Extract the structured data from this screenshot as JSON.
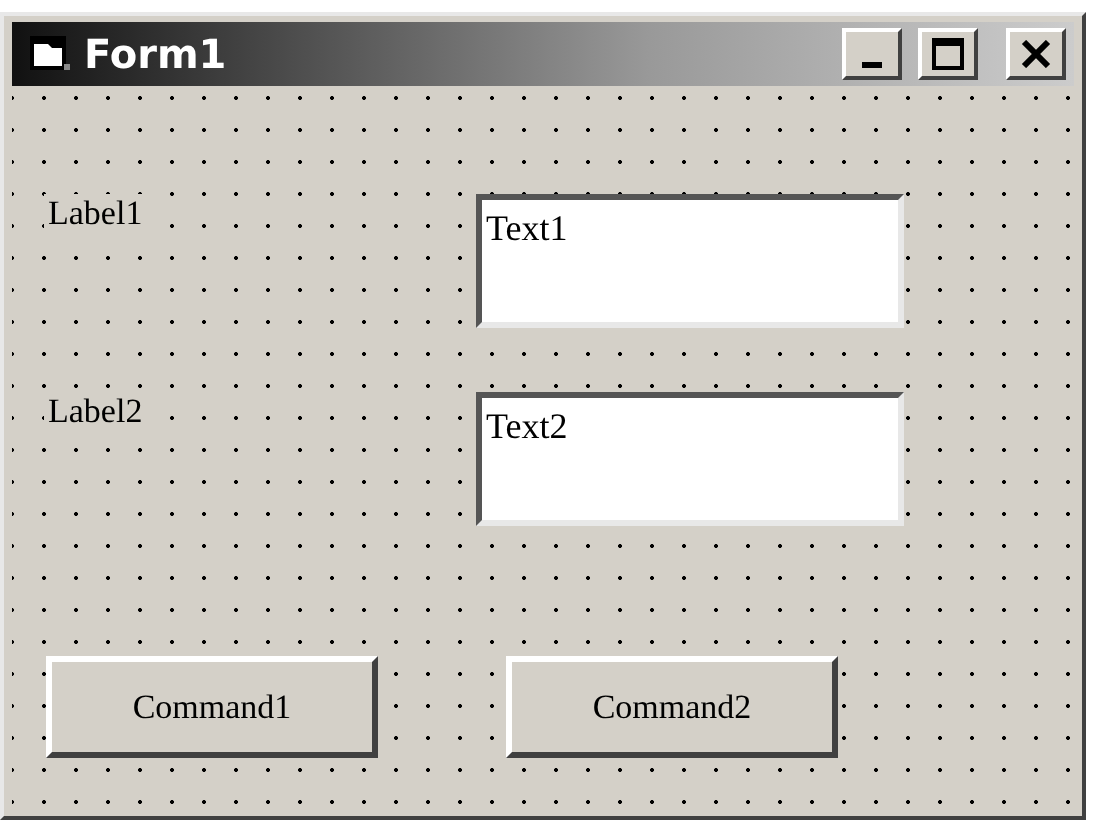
{
  "window": {
    "title": "Form1"
  },
  "labels": [
    "Label1",
    "Label2"
  ],
  "textboxes": [
    {
      "value": "Text1"
    },
    {
      "value": "Text2"
    }
  ],
  "buttons": [
    "Command1",
    "Command2"
  ]
}
